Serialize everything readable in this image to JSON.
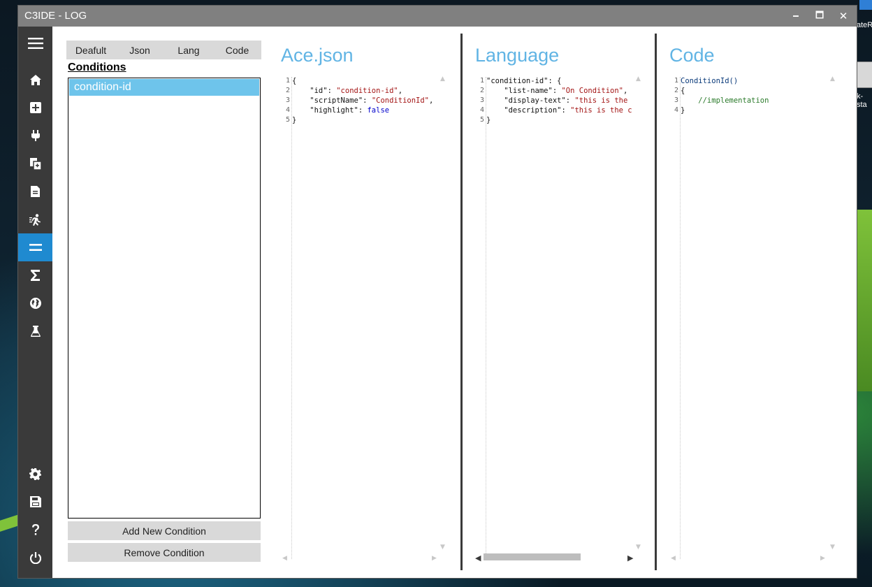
{
  "desktop": {
    "edge_text_top": "ateR",
    "edge_text_mid": "k-sta"
  },
  "window": {
    "title": "C3IDE - LOG",
    "controls": {
      "minimize": "🗕",
      "maximize": "🗖",
      "close": "✕"
    }
  },
  "sidebar": {
    "items": [
      {
        "name": "menu-icon"
      },
      {
        "name": "home-icon"
      },
      {
        "name": "add-icon"
      },
      {
        "name": "plug-icon"
      },
      {
        "name": "copy-icon"
      },
      {
        "name": "document-icon"
      },
      {
        "name": "run-icon"
      },
      {
        "name": "equals-icon",
        "active": true
      },
      {
        "name": "sigma-icon"
      },
      {
        "name": "globe-icon"
      },
      {
        "name": "flask-icon"
      },
      {
        "name": "gear-icon"
      },
      {
        "name": "save-icon"
      },
      {
        "name": "help-icon"
      },
      {
        "name": "power-icon"
      }
    ],
    "accent_color": "#1f8ad0",
    "background_color": "#3a3a3a"
  },
  "left_panel": {
    "tabs": [
      "Deafult",
      "Json",
      "Lang",
      "Code"
    ],
    "section_title": "Conditions",
    "conditions": [
      "condition-id"
    ],
    "selected_color": "#6ec4eb",
    "add_button": "Add New Condition",
    "remove_button": "Remove Condition"
  },
  "editors": {
    "ace": {
      "title": "Ace.json",
      "line_numbers": [
        "1",
        "2",
        "3",
        "4",
        "5"
      ],
      "lines": {
        "l1": "{",
        "l2_key": "    \"id\"",
        "l2_sep": ": ",
        "l2_val": "\"condition-id\"",
        "l2_end": ",",
        "l3_key": "    \"scriptName\"",
        "l3_sep": ": ",
        "l3_val": "\"ConditionId\"",
        "l3_end": ",",
        "l4_key": "    \"highlight\"",
        "l4_sep": ": ",
        "l4_val": "false",
        "l5": "}"
      }
    },
    "language": {
      "title": "Language",
      "line_numbers": [
        "1",
        "2",
        "3",
        "4",
        "5"
      ],
      "lines": {
        "l1_key": "\"condition-id\"",
        "l1_end": ": {",
        "l2_key": "    \"list-name\"",
        "l2_sep": ": ",
        "l2_val": "\"On Condition\"",
        "l2_end": ",",
        "l3_key": "    \"display-text\"",
        "l3_sep": ": ",
        "l3_val": "\"this is the",
        "l4_key": "    \"description\"",
        "l4_sep": ": ",
        "l4_val": "\"this is the c",
        "l5": "}"
      }
    },
    "code": {
      "title": "Code",
      "line_numbers": [
        "1",
        "2",
        "3",
        "4"
      ],
      "lines": {
        "l1": "ConditionId()",
        "l2": "{",
        "l3": "    //implementation",
        "l4": "}"
      }
    },
    "title_color": "#61b4e4"
  }
}
